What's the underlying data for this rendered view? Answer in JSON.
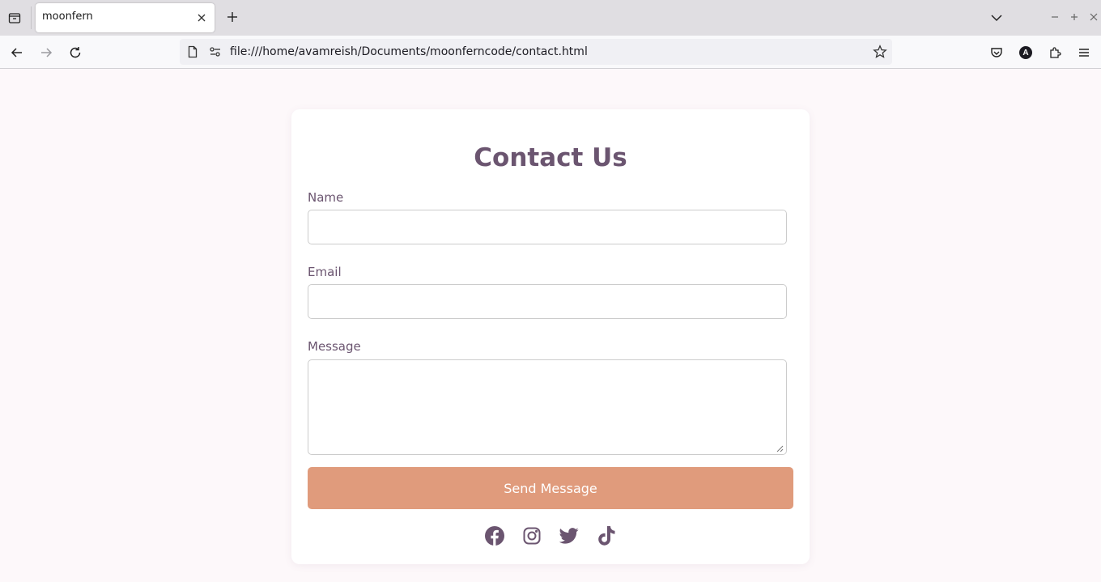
{
  "browser": {
    "tab_title": "moonfern",
    "url": "file:///home/avamreish/Documents/moonferncode/contact.html",
    "account_initial": "A"
  },
  "form": {
    "title": "Contact Us",
    "name_label": "Name",
    "name_value": "",
    "email_label": "Email",
    "email_value": "",
    "message_label": "Message",
    "message_value": "",
    "submit_label": "Send Message"
  },
  "socials": [
    {
      "icon": "facebook-icon"
    },
    {
      "icon": "instagram-icon"
    },
    {
      "icon": "twitter-icon"
    },
    {
      "icon": "tiktok-icon"
    }
  ],
  "colors": {
    "accent": "#e09b7c",
    "text": "#6b5570",
    "page_bg": "#fdf8fa"
  }
}
